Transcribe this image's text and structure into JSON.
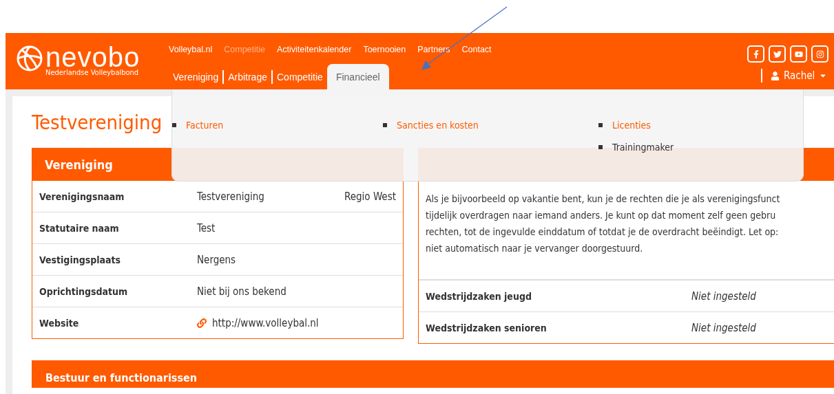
{
  "logo": {
    "name": "nevobo",
    "tagline": "Nederlandse Volleybalbond"
  },
  "top_nav": [
    {
      "label": "Volleybal.nl",
      "selected": false
    },
    {
      "label": "Competitie",
      "selected": true
    },
    {
      "label": "Activiteitenkalender",
      "selected": false
    },
    {
      "label": "Toernooien",
      "selected": false
    },
    {
      "label": "Partners",
      "selected": false
    },
    {
      "label": "Contact",
      "selected": false
    }
  ],
  "main_nav": [
    {
      "label": "Vereniging",
      "selected": false
    },
    {
      "label": "Arbitrage",
      "selected": false
    },
    {
      "label": "Competitie",
      "selected": false
    },
    {
      "label": "Financieel",
      "selected": true
    }
  ],
  "user": {
    "name": "Rachel"
  },
  "dropdown": {
    "columns": [
      [
        {
          "label": "Facturen",
          "kind": "link"
        }
      ],
      [
        {
          "label": "Sancties en kosten",
          "kind": "link"
        }
      ],
      [
        {
          "label": "Licenties",
          "kind": "link"
        },
        {
          "label": "Trainingmaker",
          "kind": "text"
        }
      ]
    ]
  },
  "page_title": "Testvereniging",
  "club_panel": {
    "title": "Vereniging",
    "rows": [
      {
        "label": "Verenigingsnaam",
        "value": "Testvereniging",
        "extra": "Regio West",
        "kind": "text"
      },
      {
        "label": "Statutaire naam",
        "value": "Test",
        "kind": "text"
      },
      {
        "label": "Vestigingsplaats",
        "value": "Nergens",
        "kind": "text"
      },
      {
        "label": "Oprichtingsdatum",
        "value": "Niet bij ons bekend",
        "kind": "text"
      },
      {
        "label": "Website",
        "value": "http://www.volleybal.nl",
        "kind": "link"
      }
    ]
  },
  "substitute_panel": {
    "text_lines": [
      "Als je bijvoorbeeld op vakantie bent, kun je de rechten die je als verenigingsfunct",
      "tijdelijk overdragen naar iemand anders. Je kunt op dat moment zelf geen gebru",
      "rechten, tot de ingevulde einddatum of totdat je de overdracht beëindigt. Let op:",
      "niet automatisch naar je vervanger doorgestuurd."
    ],
    "rows": [
      {
        "label": "Wedstrijdzaken jeugd",
        "value": "Niet ingesteld"
      },
      {
        "label": "Wedstrijdzaken senioren",
        "value": "Niet ingesteld"
      }
    ]
  },
  "board_panel": {
    "title": "Bestuur en functionarissen"
  }
}
